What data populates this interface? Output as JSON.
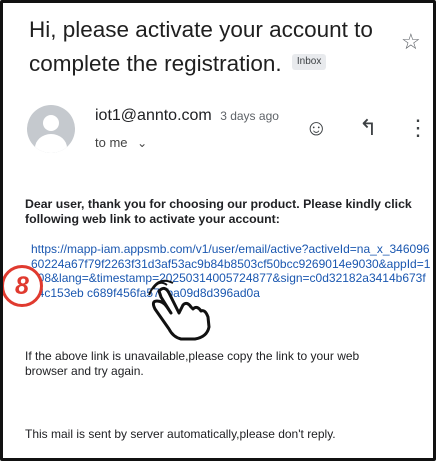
{
  "email": {
    "subject": "Hi, please activate your account to complete the registration.",
    "label_badge": "Inbox",
    "sender": "iot1@annto.com",
    "time_ago": "3 days ago",
    "recipient": "to me",
    "greeting": "Dear user, thank you for choosing our product. Please kindly click following web link to activate your account:",
    "activation_link": "https://mapp-iam.appsmb.com/v1/user/email/active?activeId=na_x_34609660224a67f79f2263f31d3af53ac9b84b8503cf50bcc9269014e9030&appId=1108&lang=&timestamp=20250314005724877&sign=c0d32182a3414b673f24c153eb c689f456fa576ba09d8d396ad0a",
    "fallback_note": "If the above link is unavailable,please copy the link to your web browser and try again.",
    "footer": "This mail is sent by server automatically,please don't reply."
  },
  "icons": {
    "star": "☆",
    "emoji": "☺",
    "reply": "↰",
    "more": "⋮",
    "chevron": "⌄"
  },
  "overlay": {
    "step_number": "8"
  },
  "colors": {
    "link": "#1a57b0",
    "step_marker": "#e03a2f"
  }
}
